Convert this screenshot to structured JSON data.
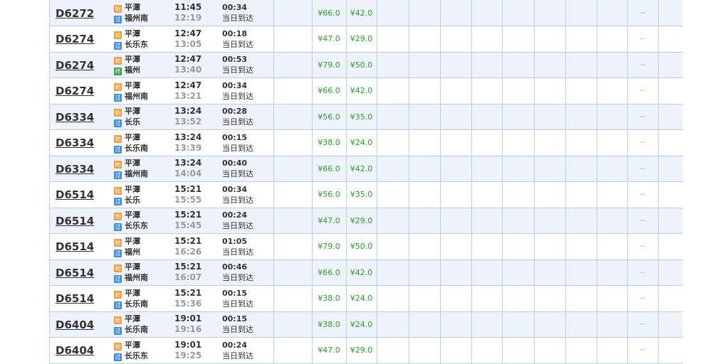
{
  "badges": {
    "start": "始",
    "pass": "过",
    "final": "终"
  },
  "colors": {
    "start": "#f39c3a",
    "pass": "#3a8ee6",
    "final": "#3aa14a",
    "price": "#2a9d2a",
    "row_alt": "#eef3fb",
    "border": "#b6d0e8"
  },
  "rows": [
    {
      "train": "D6272",
      "from": "平潭",
      "to": "福州南",
      "to_type": "pass",
      "dep": "11:45",
      "arr": "12:19",
      "duration": "00:34",
      "arrive_note": "当日到达",
      "price1": "¥66.0",
      "price2": "¥42.0",
      "other": "--"
    },
    {
      "train": "D6274",
      "from": "平潭",
      "to": "长乐东",
      "to_type": "pass",
      "dep": "12:47",
      "arr": "13:05",
      "duration": "00:18",
      "arrive_note": "当日到达",
      "price1": "¥47.0",
      "price2": "¥29.0",
      "other": "--"
    },
    {
      "train": "D6274",
      "from": "平潭",
      "to": "福州",
      "to_type": "final",
      "dep": "12:47",
      "arr": "13:40",
      "duration": "00:53",
      "arrive_note": "当日到达",
      "price1": "¥79.0",
      "price2": "¥50.0",
      "other": "--"
    },
    {
      "train": "D6274",
      "from": "平潭",
      "to": "福州南",
      "to_type": "pass",
      "dep": "12:47",
      "arr": "13:21",
      "duration": "00:34",
      "arrive_note": "当日到达",
      "price1": "¥66.0",
      "price2": "¥42.0",
      "other": "--"
    },
    {
      "train": "D6334",
      "from": "平潭",
      "to": "长乐",
      "to_type": "pass",
      "dep": "13:24",
      "arr": "13:52",
      "duration": "00:28",
      "arrive_note": "当日到达",
      "price1": "¥56.0",
      "price2": "¥35.0",
      "other": "--"
    },
    {
      "train": "D6334",
      "from": "平潭",
      "to": "长乐南",
      "to_type": "pass",
      "dep": "13:24",
      "arr": "13:39",
      "duration": "00:15",
      "arrive_note": "当日到达",
      "price1": "¥38.0",
      "price2": "¥24.0",
      "other": "--"
    },
    {
      "train": "D6334",
      "from": "平潭",
      "to": "福州南",
      "to_type": "pass",
      "dep": "13:24",
      "arr": "14:04",
      "duration": "00:40",
      "arrive_note": "当日到达",
      "price1": "¥66.0",
      "price2": "¥42.0",
      "other": "--"
    },
    {
      "train": "D6514",
      "from": "平潭",
      "to": "长乐",
      "to_type": "pass",
      "dep": "15:21",
      "arr": "15:55",
      "duration": "00:34",
      "arrive_note": "当日到达",
      "price1": "¥56.0",
      "price2": "¥35.0",
      "other": "--"
    },
    {
      "train": "D6514",
      "from": "平潭",
      "to": "长乐东",
      "to_type": "pass",
      "dep": "15:21",
      "arr": "15:45",
      "duration": "00:24",
      "arrive_note": "当日到达",
      "price1": "¥47.0",
      "price2": "¥29.0",
      "other": "--"
    },
    {
      "train": "D6514",
      "from": "平潭",
      "to": "福州",
      "to_type": "pass",
      "dep": "15:21",
      "arr": "16:26",
      "duration": "01:05",
      "arrive_note": "当日到达",
      "price1": "¥79.0",
      "price2": "¥50.0",
      "other": "--"
    },
    {
      "train": "D6514",
      "from": "平潭",
      "to": "福州南",
      "to_type": "pass",
      "dep": "15:21",
      "arr": "16:07",
      "duration": "00:46",
      "arrive_note": "当日到达",
      "price1": "¥66.0",
      "price2": "¥42.0",
      "other": "--"
    },
    {
      "train": "D6514",
      "from": "平潭",
      "to": "长乐南",
      "to_type": "pass",
      "dep": "15:21",
      "arr": "15:36",
      "duration": "00:15",
      "arrive_note": "当日到达",
      "price1": "¥38.0",
      "price2": "¥24.0",
      "other": "--"
    },
    {
      "train": "D6404",
      "from": "平潭",
      "to": "长乐南",
      "to_type": "pass",
      "dep": "19:01",
      "arr": "19:16",
      "duration": "00:15",
      "arrive_note": "当日到达",
      "price1": "¥38.0",
      "price2": "¥24.0",
      "other": "--"
    },
    {
      "train": "D6404",
      "from": "平潭",
      "to": "长乐东",
      "to_type": "pass",
      "dep": "19:01",
      "arr": "19:25",
      "duration": "00:24",
      "arrive_note": "当日到达",
      "price1": "¥47.0",
      "price2": "¥29.0",
      "other": "--"
    }
  ]
}
